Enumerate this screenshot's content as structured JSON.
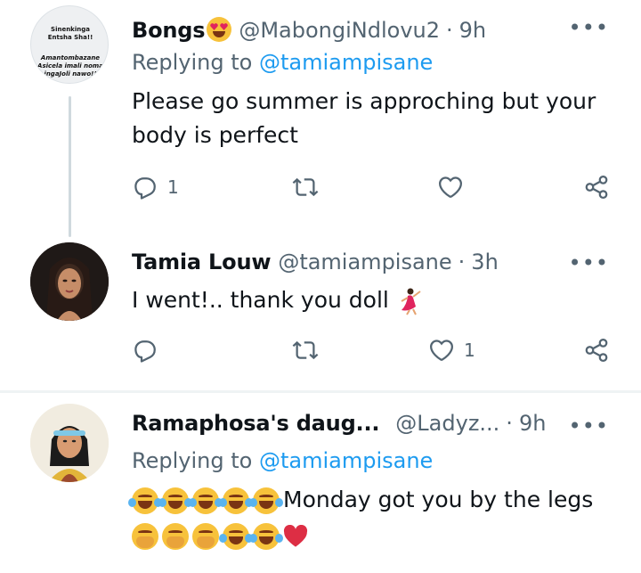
{
  "tweets": [
    {
      "name": "Bongs",
      "handle": "@MabongiNdlovu2",
      "separator": "·",
      "time": "9h",
      "more": "•••",
      "reply_prefix": "Replying to",
      "reply_mention": "@tamiampisane",
      "text_line1": "Please go summer is approching but your",
      "text_line2": "body is perfect",
      "avatar_text_top": "Sinenkinga Entsha Sha!!",
      "avatar_text_bottom": "Amantombazane Asicela imali noma ingaJoli nawo!!",
      "reply_count": "1",
      "retweet_count": "",
      "like_count": ""
    },
    {
      "name": "Tamia Louw",
      "handle": "@tamiampisane",
      "separator": "·",
      "time": "3h",
      "more": "•••",
      "text": "I went!.. thank you doll",
      "reply_count": "",
      "retweet_count": "",
      "like_count": "1"
    },
    {
      "name": "Ramaphosa's daug...",
      "handle": "@Ladyz...",
      "separator": "·",
      "time": "9h",
      "more": "•••",
      "reply_prefix": "Replying to",
      "reply_mention": "@tamiampisane",
      "text": "Monday got you by the legs"
    }
  ],
  "icons": {
    "reply": "reply-icon",
    "retweet": "retweet-icon",
    "like": "heart-icon",
    "share": "share-icon",
    "more": "more-icon"
  },
  "colors": {
    "link": "#1d9bf0",
    "secondary_text": "#536471",
    "primary_text": "#0f1419",
    "divider": "#eff3f4",
    "thread_line": "#cfd9de"
  }
}
